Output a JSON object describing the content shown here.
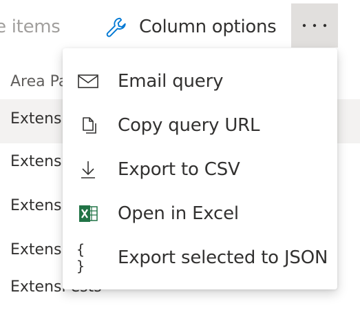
{
  "toolbar": {
    "move_items_label": "ve items",
    "column_options_label": "Column options",
    "more_icon": "ellipsis-icon"
  },
  "grid": {
    "header": "Area Pa",
    "rows": [
      "Extensi",
      "Extensi",
      "Extensi",
      "Extensi",
      "Extensi    ests"
    ]
  },
  "menu": {
    "items": [
      {
        "label": "Email query",
        "icon": "mail-icon"
      },
      {
        "label": "Copy query URL",
        "icon": "copy-icon"
      },
      {
        "label": "Export to CSV",
        "icon": "download-icon"
      },
      {
        "label": "Open in Excel",
        "icon": "excel-icon"
      },
      {
        "label": "Export selected to JSON",
        "icon": "braces-icon",
        "glyph": "{ }"
      }
    ]
  },
  "colors": {
    "accent": "#0078d4",
    "excel_green": "#217346",
    "selected_row": "#f3f2f1",
    "more_button_bg": "#e1dfdd"
  }
}
